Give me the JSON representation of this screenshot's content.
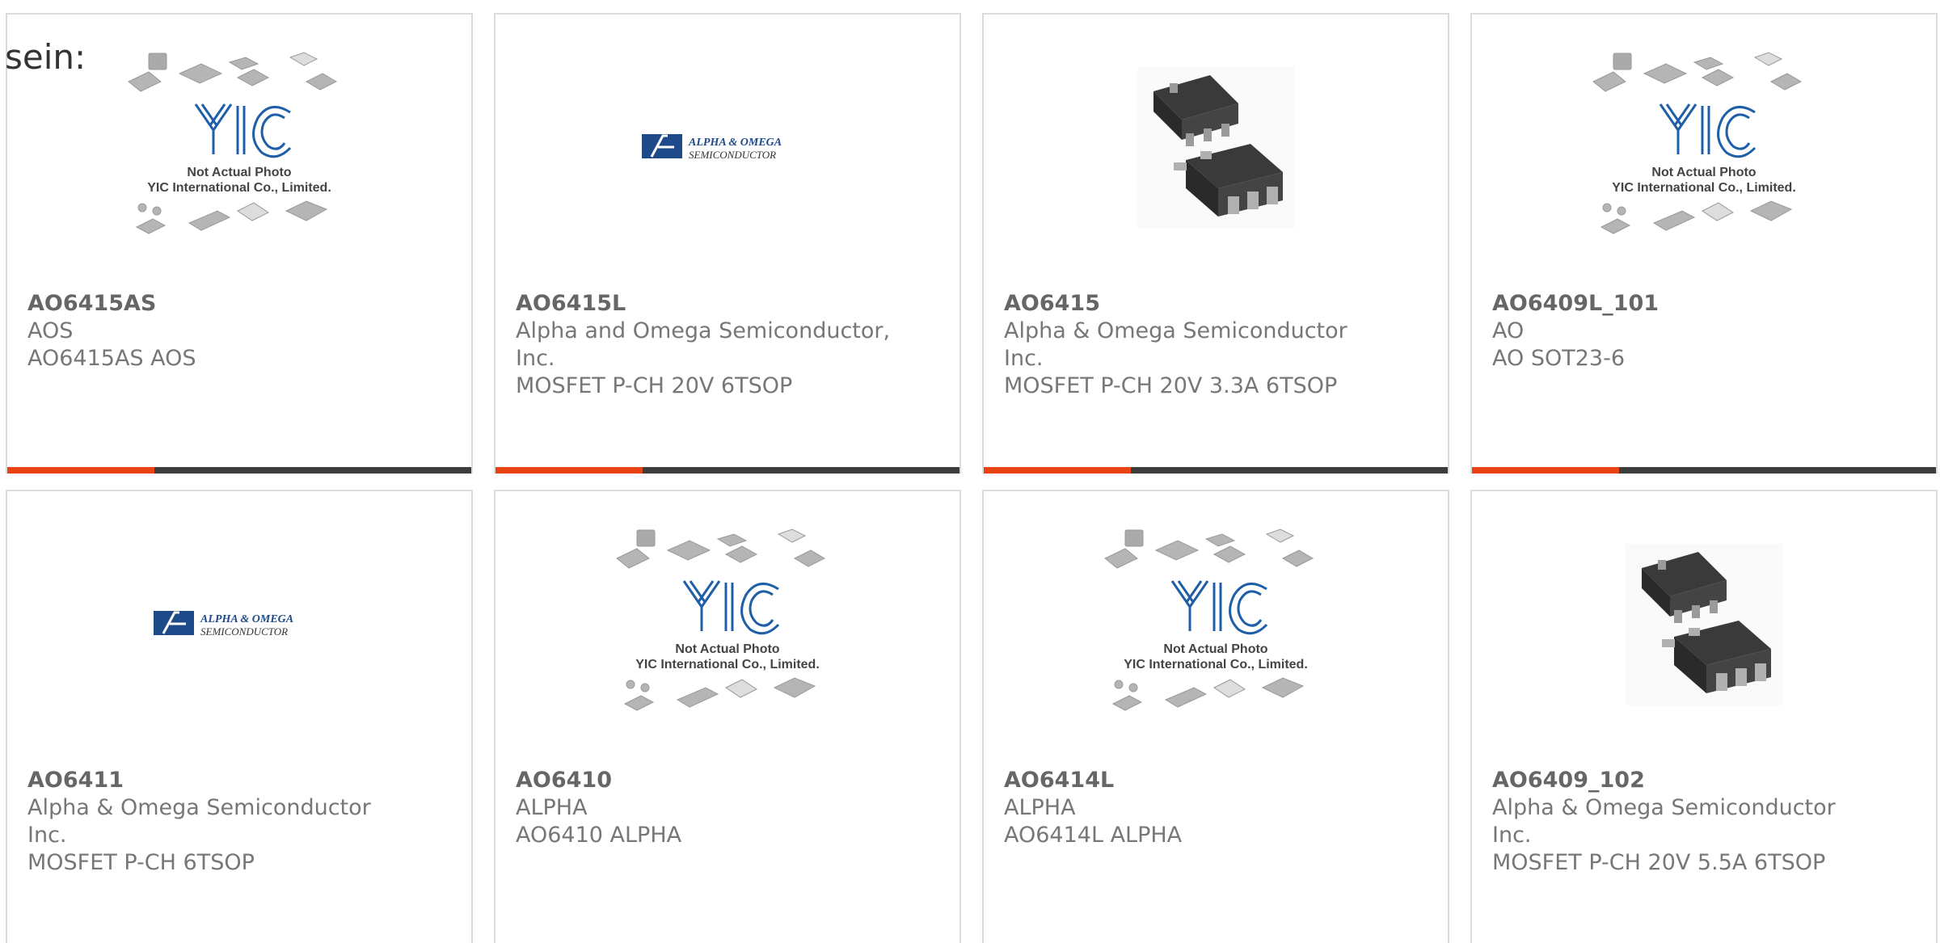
{
  "header": {
    "partial_text": "sein:"
  },
  "products": [
    {
      "part": "AO6415AS",
      "manufacturer": "AOS",
      "description_lines": [
        "AO6415AS AOS"
      ],
      "image": "yic-not-actual-photo"
    },
    {
      "part": "AO6415L",
      "manufacturer": "Alpha and Omega Semiconductor,",
      "description_lines": [
        "Inc.",
        "MOSFET P-CH 20V 6TSOP"
      ],
      "image": "alpha-omega-logo"
    },
    {
      "part": "AO6415",
      "manufacturer": "Alpha & Omega Semiconductor",
      "description_lines": [
        "Inc.",
        "MOSFET P-CH 20V 3.3A 6TSOP"
      ],
      "image": "sot23-6-chip"
    },
    {
      "part": "AO6409L_101",
      "manufacturer": "AO",
      "description_lines": [
        "AO SOT23-6"
      ],
      "image": "yic-not-actual-photo"
    },
    {
      "part": "AO6411",
      "manufacturer": "Alpha & Omega Semiconductor",
      "description_lines": [
        "Inc.",
        "MOSFET P-CH 6TSOP"
      ],
      "image": "alpha-omega-logo"
    },
    {
      "part": "AO6410",
      "manufacturer": "ALPHA",
      "description_lines": [
        "AO6410 ALPHA"
      ],
      "image": "yic-not-actual-photo"
    },
    {
      "part": "AO6414L",
      "manufacturer": "ALPHA",
      "description_lines": [
        "AO6414L ALPHA"
      ],
      "image": "yic-not-actual-photo"
    },
    {
      "part": "AO6409_102",
      "manufacturer": "Alpha & Omega Semiconductor",
      "description_lines": [
        "Inc.",
        "MOSFET P-CH 20V 5.5A 6TSOP"
      ],
      "image": "sot23-6-chip"
    }
  ],
  "yic_placeholder": {
    "line1": "Not Actual Photo",
    "line2": "YIC International Co., Limited.",
    "mark": "YIC"
  },
  "ao_logo": {
    "line1": "ALPHA & OMEGA",
    "line2": "SEMICONDUCTOR"
  },
  "colors": {
    "accent": "#e84215",
    "bar": "#3d3d3d",
    "border": "#dcdcdc",
    "logo_blue": "#1f5fa8"
  }
}
